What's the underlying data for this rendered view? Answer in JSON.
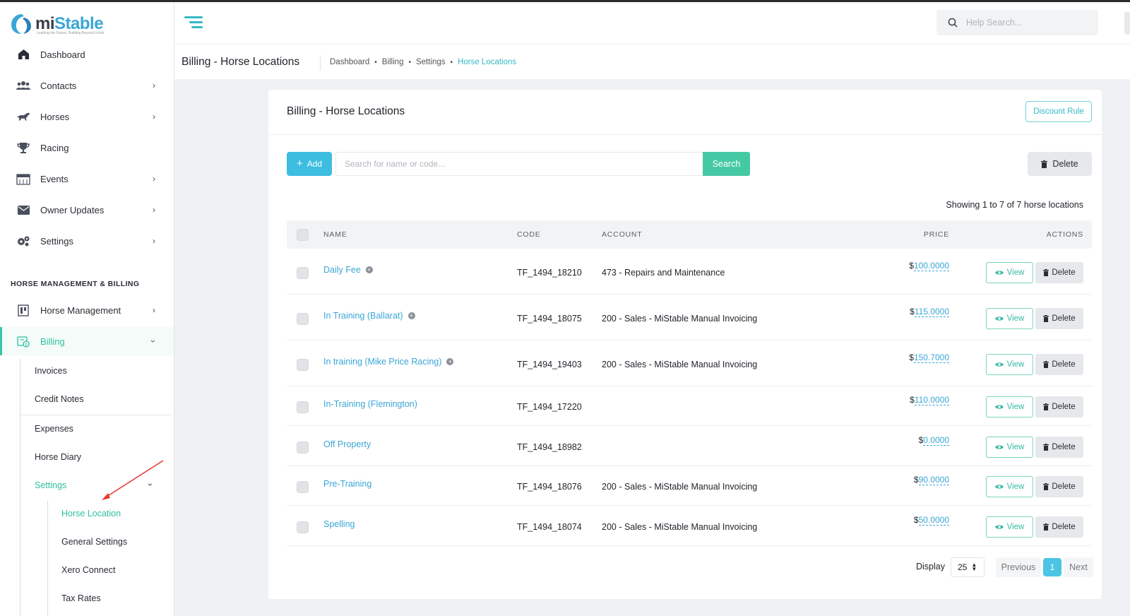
{
  "app": {
    "logo_text_a": "mi",
    "logo_text_b": "Stable",
    "logo_tagline": "Leading the Future, Building Beyond Limits"
  },
  "sidebar": {
    "items": [
      {
        "label": "Dashboard",
        "icon": "home-icon"
      },
      {
        "label": "Contacts",
        "icon": "users-icon"
      },
      {
        "label": "Horses",
        "icon": "horse-icon"
      },
      {
        "label": "Racing",
        "icon": "trophy-icon"
      },
      {
        "label": "Events",
        "icon": "calendar-icon"
      },
      {
        "label": "Owner Updates",
        "icon": "envelope-icon"
      },
      {
        "label": "Settings",
        "icon": "gears-icon"
      }
    ],
    "section_title": "HORSE MANAGEMENT & BILLING",
    "section_items": [
      {
        "label": "Horse Management",
        "icon": "clipboard-icon"
      },
      {
        "label": "Billing",
        "icon": "billing-icon"
      }
    ],
    "billing_sub": [
      "Invoices",
      "Credit Notes",
      "Expenses",
      "Horse Diary",
      "Settings"
    ],
    "settings_sub": [
      "Horse Location",
      "General Settings",
      "Xero Connect",
      "Tax Rates"
    ]
  },
  "header": {
    "help_placeholder": "Help Search..."
  },
  "titlebar": {
    "title": "Billing - Horse Locations",
    "breadcrumb": [
      "Dashboard",
      "Billing",
      "Settings",
      "Horse Locations"
    ]
  },
  "card": {
    "title": "Billing - Horse Locations",
    "discount_label": "Discount Rule",
    "add_label": "Add",
    "search_placeholder": "Search for name or code...",
    "search_label": "Search",
    "delete_label": "Delete",
    "showing": "Showing 1 to 7 of 7 horse locations",
    "columns": {
      "name": "NAME",
      "code": "CODE",
      "account": "ACCOUNT",
      "price": "PRICE",
      "actions": "ACTIONS"
    },
    "rows": [
      {
        "name": "Daily Fee",
        "has_plus": true,
        "code": "TF_1494_18210",
        "account": "473 - Repairs and Maintenance",
        "currency": "$",
        "price": "100.0000"
      },
      {
        "name": "In Training (Ballarat)",
        "has_plus": true,
        "code": "TF_1494_18075",
        "account": "200 - Sales - MiStable Manual Invoicing",
        "currency": "$",
        "price": "115.0000"
      },
      {
        "name": "In training (Mike Price Racing)",
        "has_plus": true,
        "code": "TF_1494_19403",
        "account": "200 - Sales - MiStable Manual Invoicing",
        "currency": "$",
        "price": "150.7000"
      },
      {
        "name": "In-Training (Flemington)",
        "has_plus": false,
        "code": "TF_1494_17220",
        "account": "",
        "currency": "$",
        "price": "110.0000"
      },
      {
        "name": "Off Property",
        "has_plus": false,
        "code": "TF_1494_18982",
        "account": "",
        "currency": "$",
        "price": "0.0000"
      },
      {
        "name": "Pre-Training",
        "has_plus": false,
        "code": "TF_1494_18076",
        "account": "200 - Sales - MiStable Manual Invoicing",
        "currency": "$",
        "price": "90.0000"
      },
      {
        "name": "Spelling",
        "has_plus": false,
        "code": "TF_1494_18074",
        "account": "200 - Sales - MiStable Manual Invoicing",
        "currency": "$",
        "price": "50.0000"
      }
    ],
    "view_label": "View",
    "row_delete_label": "Delete",
    "pagination": {
      "display_label": "Display",
      "page_size": "25",
      "prev": "Previous",
      "current": "1",
      "next": "Next"
    }
  },
  "colors": {
    "accent_teal": "#2ebf9e",
    "link_blue": "#3aa6d6",
    "add_button": "#3dbde0",
    "search_button": "#45c9a5",
    "annotation_arrow": "#e53935"
  }
}
